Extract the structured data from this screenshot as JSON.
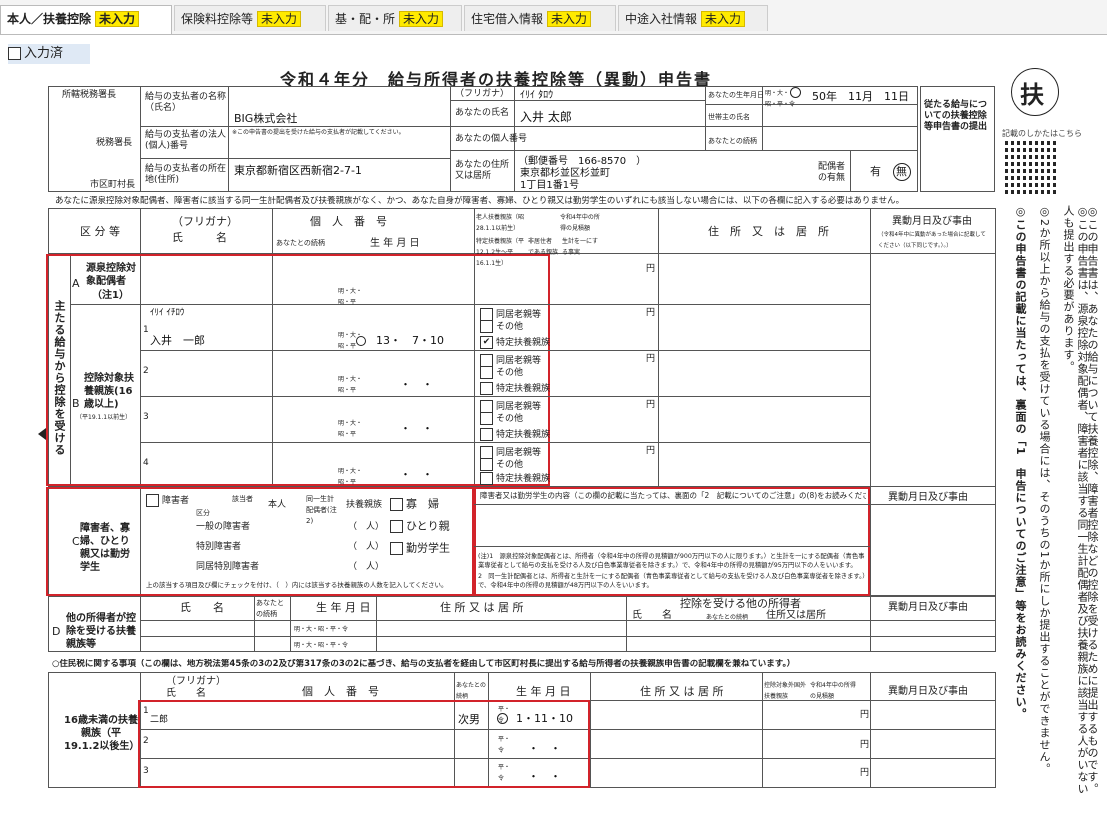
{
  "tabs": [
    {
      "label": "本人／扶養控除",
      "badge": "未入力",
      "active": true
    },
    {
      "label": "保険料控除等",
      "badge": "未入力",
      "active": false
    },
    {
      "label": "基・配・所",
      "badge": "未入力",
      "active": false
    },
    {
      "label": "住宅借入情報",
      "badge": "未入力",
      "active": false
    },
    {
      "label": "中途入社情報",
      "badge": "未入力",
      "active": false
    }
  ],
  "status": {
    "entered_label": "入力済"
  },
  "form": {
    "title": "令和４年分　給与所得者の扶養控除等（異動）申告書",
    "fu_label": "扶",
    "side_link": "記載のしかたはこちら",
    "left_labels": {
      "tax_office": "所轄税務署長",
      "tax_office_head": "税務署長",
      "city_head": "市区町村長",
      "payer_name": "給与の支払者の名称（氏名）",
      "payer_number": "給与の支払者の法人(個人)番号",
      "payer_note": "※この申告書の提出を受けた給与の支払者が記載してください。",
      "payer_address": "給与の支払者の所在地(住所)"
    },
    "payer_name_value": "BIG株式会社",
    "payer_address_value": "東京都新宿区西新宿2-7-1",
    "you": {
      "furigana_label": "（フリガナ）",
      "furigana_value": "ｲﾘｲ ﾀﾛｳ",
      "name_label": "あなたの氏名",
      "name_value": "入井 太郎",
      "number_label": "あなたの個人番号",
      "address_label": "あなたの住所又は居所",
      "postal": "（郵便番号　166-8570　）",
      "address1": "東京都杉並区杉並町",
      "address2": "1丁目1番1号",
      "birth_label": "あなたの生年月日",
      "birth_era": "明・大・昭・平・令",
      "birth_value": "50年　11月　11日",
      "householder_label": "世帯主の氏名",
      "relation_label": "あなたとの続柄",
      "spouse_label": "配偶者の有無",
      "spouse_yes": "有",
      "spouse_no": "無",
      "main_pay_note": "従たる給与についての扶養控除等申告書の提出"
    },
    "notice_line": "あなたに源泉控除対象配偶者、障害者に該当する同一生計配偶者及び扶養親族がなく、かつ、あなた自身が障害者、寡婦、ひとり親又は勤労学生のいずれにも該当しない場合には、以下の各欄に記入する必要はありません。",
    "headers": {
      "kubun": "区 分 等",
      "furigana": "（フリガナ）",
      "shimei": "氏　　　名",
      "kojin": "個　人　番　号",
      "relation": "あなたとの続柄",
      "birth": "生 年 月 日",
      "elderly": "老人扶養親族（昭28.1.1以前生）",
      "special": "特定扶養親族（平12.1.2生～平16.1.1生）",
      "income": "令和4年中の所得の見積額",
      "nonres": "非居住者である親族",
      "living": "生計を一にする事実",
      "address": "住　所　又　は　居　所",
      "change": "異動月日及び事由",
      "change_note": "（令和4年中に異動があった場合に記載してください（以下同じです。）。）"
    },
    "vertical_main": "主たる給与から控除を受ける",
    "sectionA": {
      "title": "源泉控除対象配偶者",
      "note": "（注1）",
      "letter": "A",
      "era": "明・大・昭・平"
    },
    "sectionB": {
      "title": "控除対象扶養親族(16歳以上)",
      "note": "（平19.1.1以前生）",
      "letter": "B",
      "rows": [
        {
          "no": "1",
          "furigana": "ｲﾘｲ ｲﾁﾛｳ",
          "name": "入井　一郎",
          "era": "明・大・昭・平",
          "birth": "13・　7・10"
        },
        {
          "no": "2",
          "furigana": "",
          "name": "",
          "era": "明・大・昭・平",
          "birth": "・　・"
        },
        {
          "no": "3",
          "furigana": "",
          "name": "",
          "era": "明・大・昭・平",
          "birth": "・　・"
        },
        {
          "no": "4",
          "furigana": "",
          "name": "",
          "era": "明・大・昭・平",
          "birth": "・　・"
        }
      ],
      "opt_elderly": "同居老親等",
      "opt_other": "その他",
      "opt_special": "特定扶養親族",
      "yen": "円"
    },
    "sectionC": {
      "letter": "C",
      "title": "障害者、寡婦、ひとり親又は勤労学生",
      "disabled": "障害者",
      "col_kubun": "区分",
      "col_applicable": "該当者",
      "col_self": "本人",
      "col_same": "同一生計配偶者(注2)",
      "col_dep": "扶養親族",
      "rows": [
        "一般の障害者",
        "特別障害者",
        "同居特別障害者"
      ],
      "unit": "（　人）",
      "widow": "寡　婦",
      "single": "ひとり親",
      "student": "勤労学生",
      "bottom_note": "上の該当する項目及び欄にチェックを付け、（　）内には該当する扶養親族の人数を記入してください。",
      "content_header": "障害者又は勤労学生の内容（この欄の記載に当たっては、裏面の「2　記載についてのご注意」の(8)をお読みください。）",
      "change": "異動月日及び事由",
      "note1": "(注)1　源泉控除対象配偶者とは、所得者（令和4年中の所得の見積額が900万円以下の人に限ります。）と生計を一にする配偶者（青色事業専従者として給与の支払を受ける人及び白色事業専従者を除きます。）で、令和4年中の所得の見積額が95万円以下の人をいいます。",
      "note2": "2　同一生計配偶者とは、所得者と生計を一にする配偶者（青色事業専従者として給与の支払を受ける人及び白色事業専従者を除きます。）で、令和4年中の所得の見積額が48万円以下の人をいいます。"
    },
    "sectionD": {
      "letter": "D",
      "title": "他の所得者が控除を受ける扶養親族等",
      "name": "氏　　名",
      "relation": "あなたとの続柄",
      "birth": "生 年 月 日",
      "address": "住 所 又 は 居 所",
      "other_header": "控除を受ける他の所得者",
      "other_name": "氏　　名",
      "other_relation": "あなたとの続柄",
      "other_address": "住所又は居所",
      "change": "異動月日及び事由",
      "era": "明・大・昭・平・令"
    },
    "resident": {
      "header": "○住民税に関する事項（この欄は、地方税法第45条の3の2及び第317条の3の2に基づき、給与の支払者を経由して市区町村長に提出する給与所得者の扶養親族申告書の記載欄を兼ねています。）",
      "title": "16歳未満の扶養親族（平19.1.2以後生）",
      "furigana": "（フリガナ）",
      "shimei": "氏　　名",
      "kojin": "個　人　番　号",
      "relation": "あなたとの続柄",
      "birth": "生 年 月 日",
      "address": "住 所 又 は 居 所",
      "overseas": "控除対象外国外扶養親族",
      "income": "令和4年中の所得の見積額",
      "change": "異動月日及び事由",
      "yen": "円",
      "era": "平・令",
      "rows": [
        {
          "no": "1",
          "name": "二郎",
          "relation": "次男",
          "birth": "1・11・10"
        },
        {
          "no": "2",
          "name": "",
          "relation": "",
          "birth": "・　・"
        },
        {
          "no": "3",
          "name": "",
          "relation": "",
          "birth": "・　・"
        }
      ]
    },
    "right_notes": [
      "◎この申告書は、あなたの給与について扶養控除、障害者控除などの控除を受けるために提出するものです。",
      "◎この申告書は、源泉控除対象配偶者、障害者に該当する同一生計配偶者及び扶養親族に該当する人がいない人も提出する必要があります。",
      "◎2か所以上から給与の支払を受けている場合には、そのうちの1か所にしか提出することができません。",
      "◎この申告書の記載に当たっては、裏面の「1　申告についてのご注意」等をお読みください。"
    ]
  }
}
